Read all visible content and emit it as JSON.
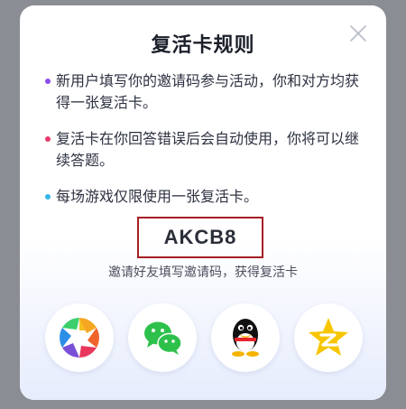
{
  "dialog": {
    "title": "复活卡规则",
    "rules": [
      {
        "text": "新用户填写你的邀请码参与活动，你和对方均获得一张复活卡。",
        "color": "#8a4de8"
      },
      {
        "text": "复活卡在你回答错误后会自动使用，你将可以继续答题。",
        "color": "#ea3a6a"
      },
      {
        "text": "每场游戏仅限使用一张复活卡。",
        "color": "#34b6e8"
      }
    ],
    "invite_code": "AKCB8",
    "hint": "邀请好友填写邀请码，获得复活卡",
    "share_targets": [
      {
        "icon": "aperture-icon"
      },
      {
        "icon": "wechat-icon"
      },
      {
        "icon": "qq-penguin-icon"
      },
      {
        "icon": "qzone-star-icon"
      }
    ]
  }
}
